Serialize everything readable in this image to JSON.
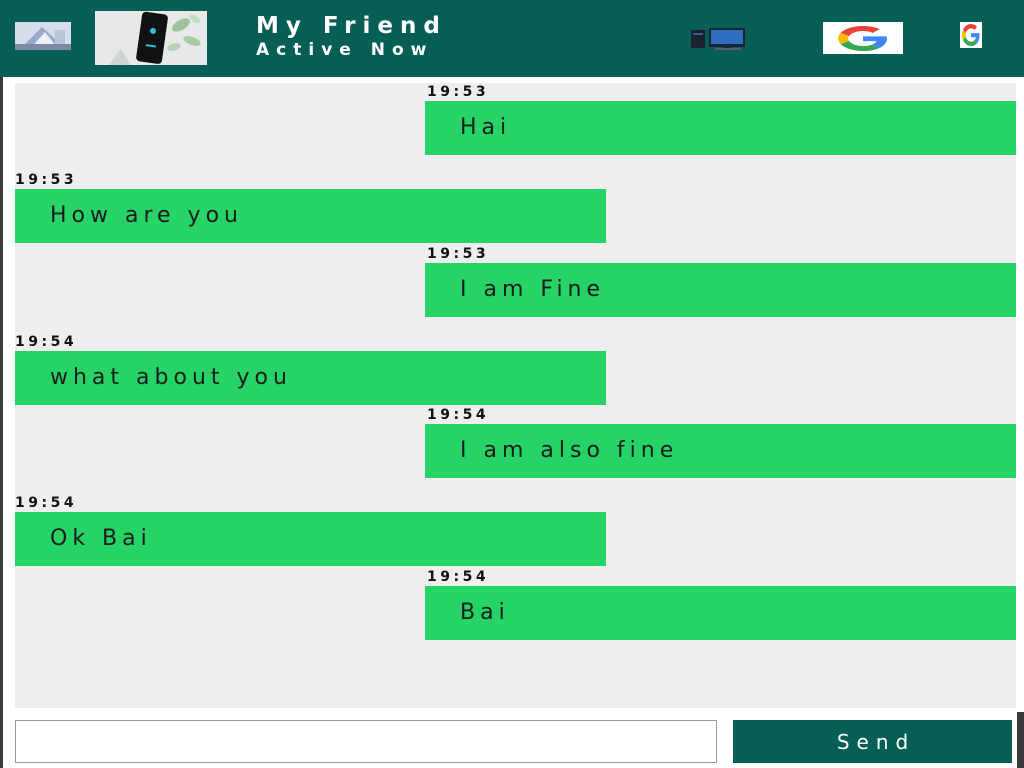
{
  "colors": {
    "header": "#075e54",
    "chat_background": "#eeeeee",
    "bubble": "#25d366",
    "send_button": "#075e54"
  },
  "header": {
    "title": "My Friend",
    "status": "Active Now",
    "icons": {
      "thumbnail": "photo-thumbnail-icon",
      "avatar": "profile-avatar",
      "computer": "computer-icon",
      "google_logo": "google-logo",
      "google_small": "google-g-icon"
    }
  },
  "messages": [
    {
      "direction": "sent",
      "time": "19:53",
      "text": "Hai"
    },
    {
      "direction": "received",
      "time": "19:53",
      "text": "How are you"
    },
    {
      "direction": "sent",
      "time": "19:53",
      "text": "I am Fine"
    },
    {
      "direction": "received",
      "time": "19:54",
      "text": "what about you"
    },
    {
      "direction": "sent",
      "time": "19:54",
      "text": "I am also fine"
    },
    {
      "direction": "received",
      "time": "19:54",
      "text": "Ok Bai"
    },
    {
      "direction": "sent",
      "time": "19:54",
      "text": "Bai"
    }
  ],
  "composer": {
    "input_value": "",
    "send_label": "Send"
  }
}
